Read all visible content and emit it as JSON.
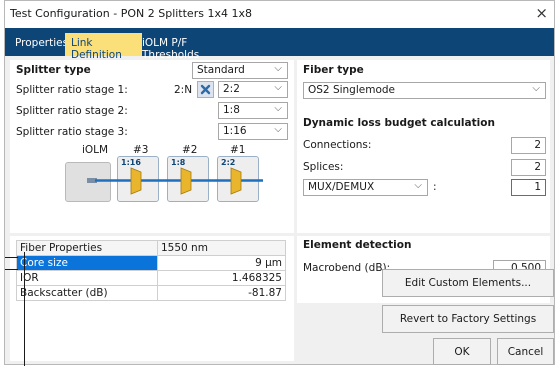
{
  "window": {
    "title": "Test Configuration - PON 2 Splitters 1x4 1x8",
    "close_glyph": "×"
  },
  "tabs": [
    {
      "label": "Properties",
      "active": false
    },
    {
      "label": "Link Definition",
      "active": true
    },
    {
      "label": "iOLM P/F Thresholds",
      "active": false
    }
  ],
  "splitter": {
    "heading": "Splitter type",
    "type_value": "Standard",
    "stage1_label": "Splitter ratio stage 1:",
    "stage1_prefix": "2:N",
    "stage1_value": "2:2",
    "stage2_label": "Splitter ratio stage 2:",
    "stage2_value": "1:8",
    "stage3_label": "Splitter ratio stage 3:",
    "stage3_value": "1:16",
    "diagram": {
      "headers": [
        "iOLM",
        "#3",
        "#2",
        "#1"
      ],
      "boxes": [
        "1:16",
        "1:8",
        "2:2"
      ]
    }
  },
  "fiber_props": {
    "columns": [
      "Fiber Properties",
      "1550 nm"
    ],
    "rows": [
      {
        "label": "Core size",
        "value": "9 µm",
        "selected": true
      },
      {
        "label": "IOR",
        "value": "1.468325",
        "selected": false
      },
      {
        "label": "Backscatter (dB)",
        "value": "-81.87",
        "selected": false
      }
    ]
  },
  "fiber_type": {
    "heading": "Fiber type",
    "value": "OS2 Singlemode"
  },
  "loss_budget": {
    "heading": "Dynamic loss budget calculation",
    "connections_label": "Connections:",
    "connections_value": "2",
    "splices_label": "Splices:",
    "splices_value": "2",
    "mux_value": "MUX/DEMUX",
    "mux_colon": ":",
    "mux_count": "1"
  },
  "element_detection": {
    "heading": "Element detection",
    "macrobend_label": "Macrobend (dB):",
    "macrobend_value": "0.500"
  },
  "buttons": {
    "edit_custom": "Edit Custom Elements...",
    "revert": "Revert to Factory Settings",
    "ok": "OK",
    "cancel": "Cancel"
  },
  "colors": {
    "tab_bar": "#0e4577",
    "tab_active": "#fbe07a",
    "selection": "#0a74da",
    "splitter_gold": "#e9b52c"
  }
}
